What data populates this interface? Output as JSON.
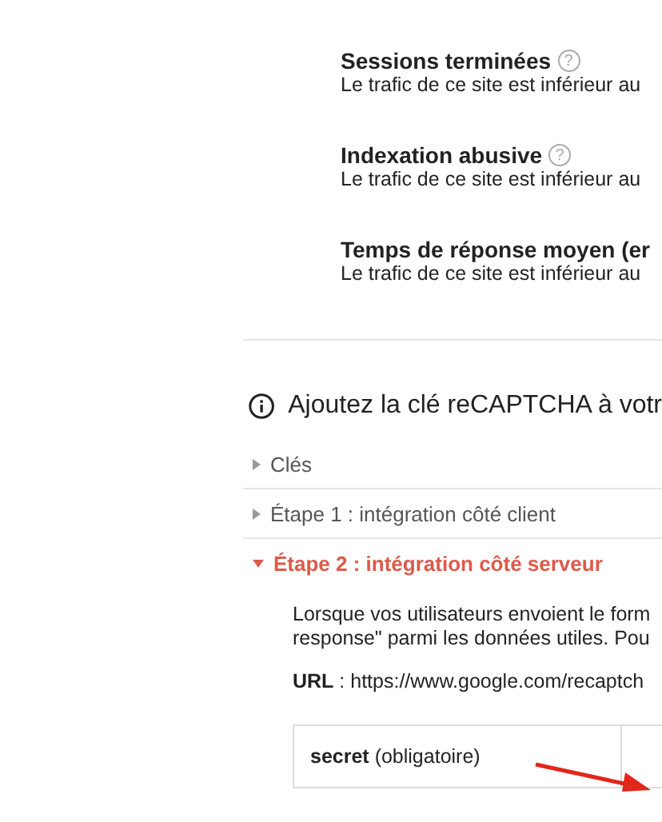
{
  "metrics": [
    {
      "title": "Sessions terminées",
      "help": "?",
      "description": "Le trafic de ce site est inférieur au"
    },
    {
      "title": "Indexation abusive",
      "help": "?",
      "description": "Le trafic de ce site est inférieur au"
    },
    {
      "title": "Temps de réponse moyen (er",
      "description": "Le trafic de ce site est inférieur au"
    }
  ],
  "notice": "Ajoutez la clé reCAPTCHA à votr",
  "sections": [
    {
      "label": "Clés",
      "expanded": false
    },
    {
      "label": "Étape 1 : intégration côté client",
      "expanded": false
    },
    {
      "label": "Étape 2 : intégration côté serveur",
      "expanded": true
    }
  ],
  "step_text": [
    "Lorsque vos utilisateurs envoient le form",
    "response\" parmi les données utiles. Pou"
  ],
  "url": {
    "label": "URL",
    "value": " : https://www.google.com/recaptch"
  },
  "table": {
    "rows": [
      {
        "name": "secret",
        "note": " (obligatoire)"
      }
    ]
  }
}
